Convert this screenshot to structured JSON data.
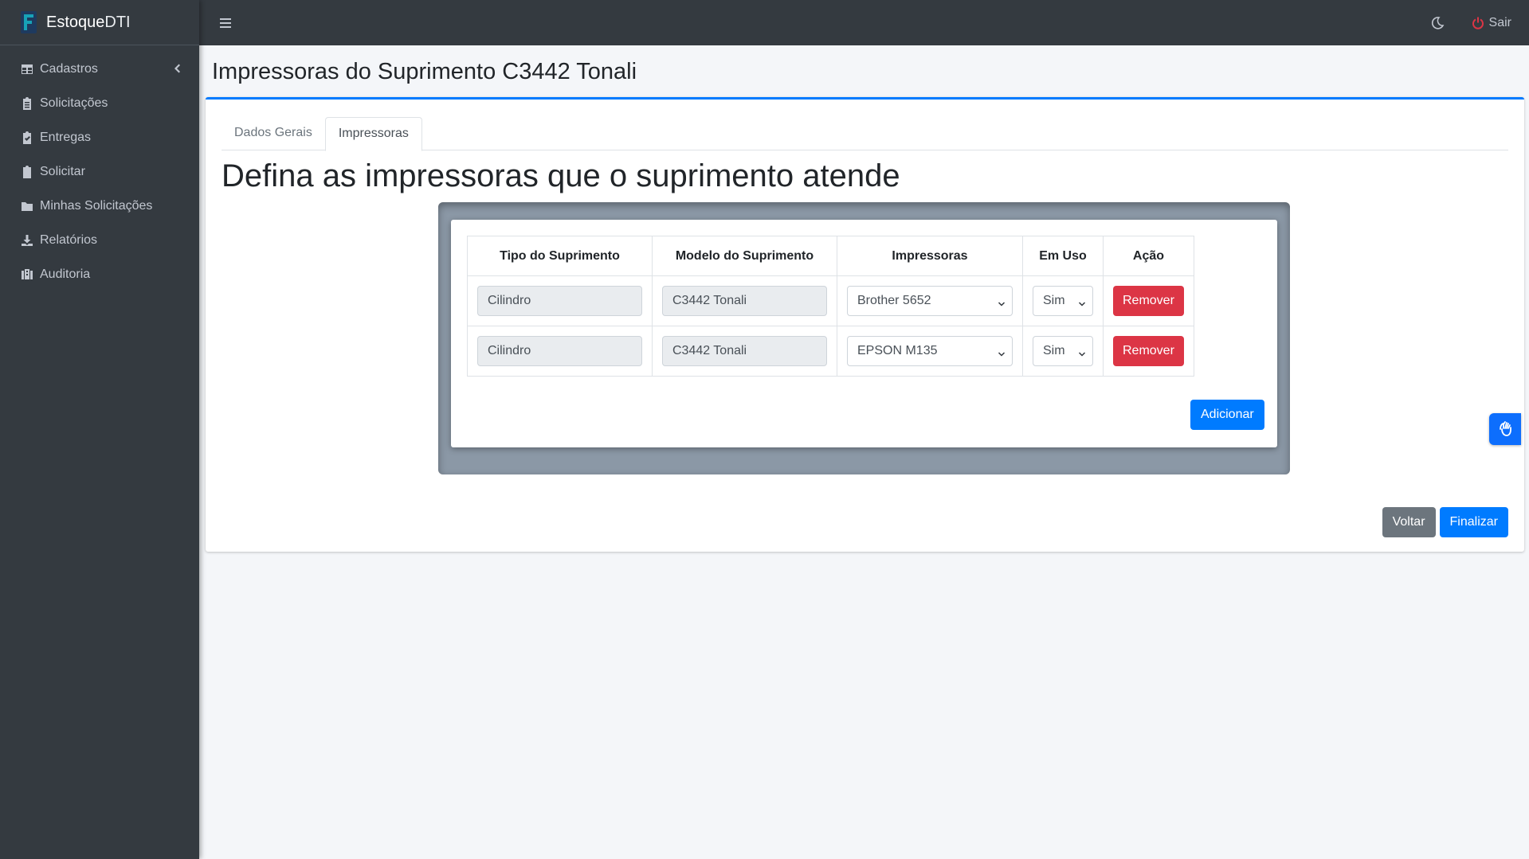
{
  "brand": {
    "name_bold": "Estoque",
    "name_light": "DTI"
  },
  "sidebar": {
    "items": [
      {
        "label": "Cadastros",
        "icon": "table-icon"
      },
      {
        "label": "Solicitações",
        "icon": "clipboard-list-icon"
      },
      {
        "label": "Entregas",
        "icon": "clipboard-check-icon"
      },
      {
        "label": "Solicitar",
        "icon": "clipboard-icon"
      },
      {
        "label": "Minhas Solicitações",
        "icon": "folder-icon"
      },
      {
        "label": "Relatórios",
        "icon": "download-icon"
      },
      {
        "label": "Auditoria",
        "icon": "building-icon"
      }
    ]
  },
  "topbar": {
    "logout_label": "Sair"
  },
  "page": {
    "title": "Impressoras do Suprimento C3442 Tonali",
    "tabs": [
      "Dados Gerais",
      "Impressoras"
    ],
    "active_tab": "Impressoras",
    "section_title": "Defina as impressoras que o suprimento atende"
  },
  "table": {
    "headers": [
      "Tipo do Suprimento",
      "Modelo do Suprimento",
      "Impressoras",
      "Em Uso",
      "Ação"
    ],
    "rows": [
      {
        "tipo": "Cilindro",
        "modelo": "C3442 Tonali",
        "impressora": "Brother 5652",
        "em_uso": "Sim",
        "acao": "Remover"
      },
      {
        "tipo": "Cilindro",
        "modelo": "C3442 Tonali",
        "impressora": "EPSON M135",
        "em_uso": "Sim",
        "acao": "Remover"
      }
    ]
  },
  "buttons": {
    "add": "Adicionar",
    "back": "Voltar",
    "finish": "Finalizar"
  },
  "colors": {
    "primary": "#007bff",
    "danger": "#dc3545",
    "secondary": "#6c757d",
    "sidebar": "#343a40",
    "logout_icon": "#dc3545"
  }
}
